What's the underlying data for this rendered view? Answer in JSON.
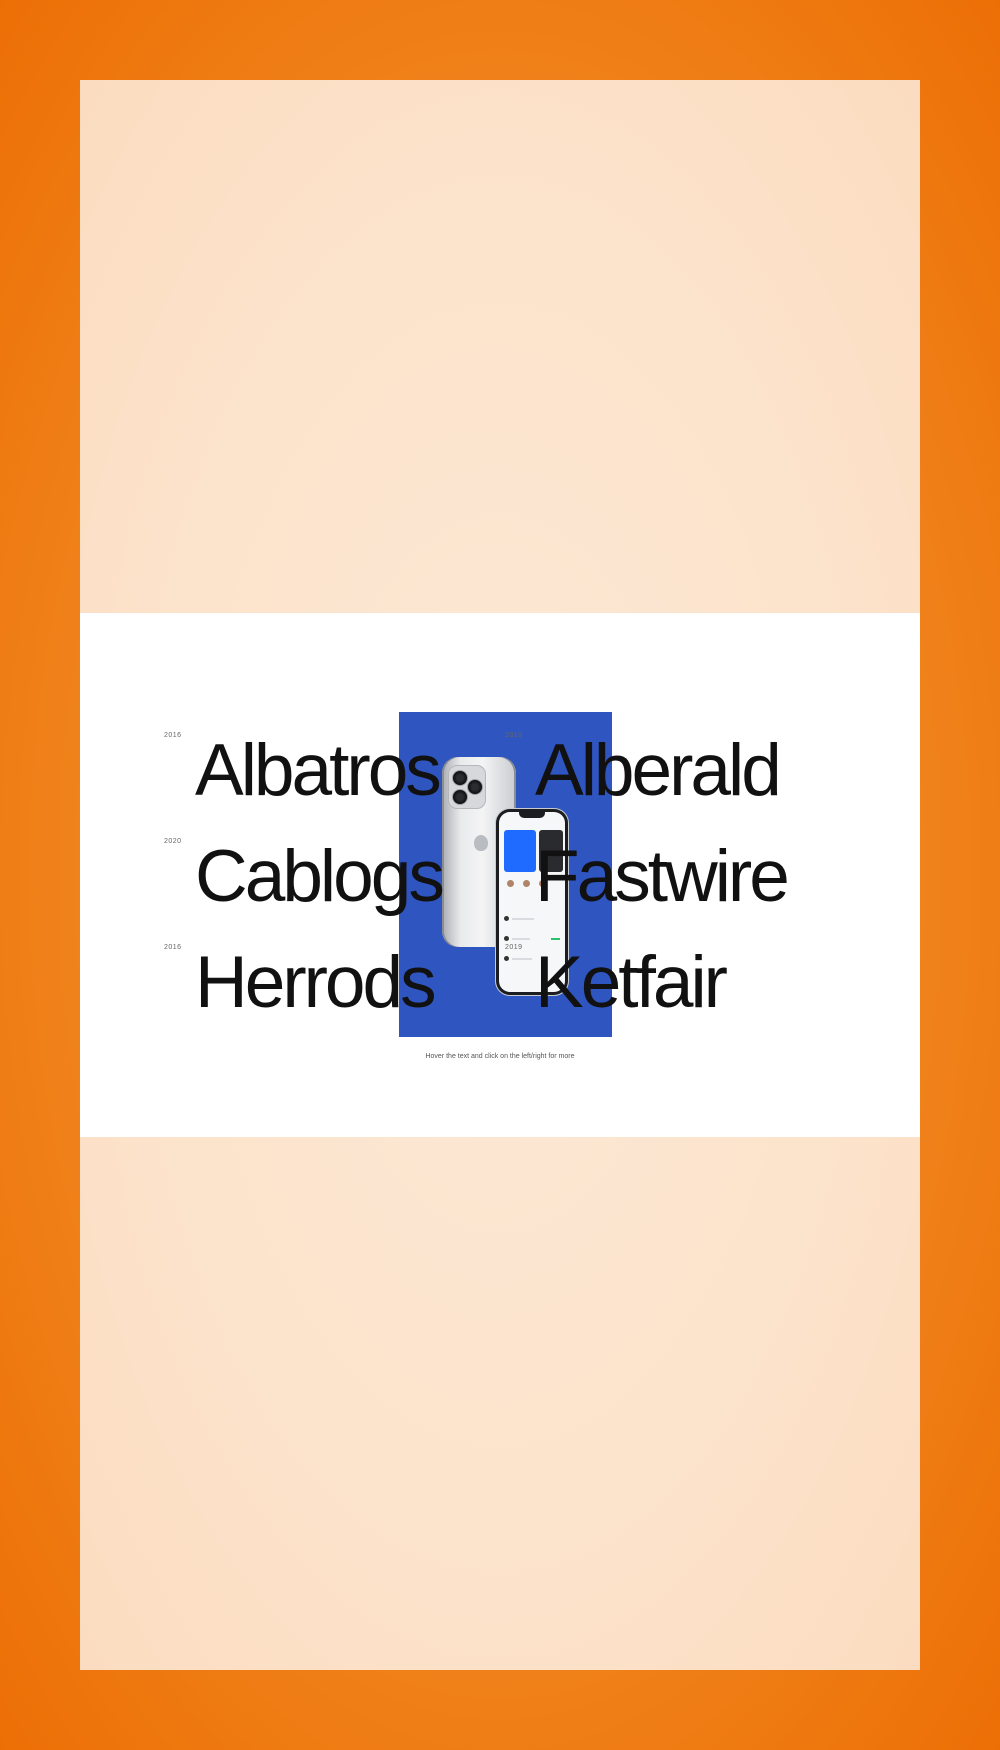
{
  "colors": {
    "outer_background": "#f28a24",
    "canvas_background": "#fce3cb",
    "stage_background": "#ffffff",
    "preview_background": "#2f55c0",
    "text": "#111111"
  },
  "projects": [
    {
      "name": "Albatros",
      "year": "2016"
    },
    {
      "name": "Alberald",
      "year": "2019"
    },
    {
      "name": "Cablogs",
      "year": "2020"
    },
    {
      "name": "Fastwire",
      "year": ""
    },
    {
      "name": "Herrods",
      "year": "2016"
    },
    {
      "name": "Ketfair",
      "year": "2019"
    }
  ],
  "preview": {
    "image": "iphone-mockup-image"
  },
  "hint": "Hover the text and click on the left/right for more"
}
